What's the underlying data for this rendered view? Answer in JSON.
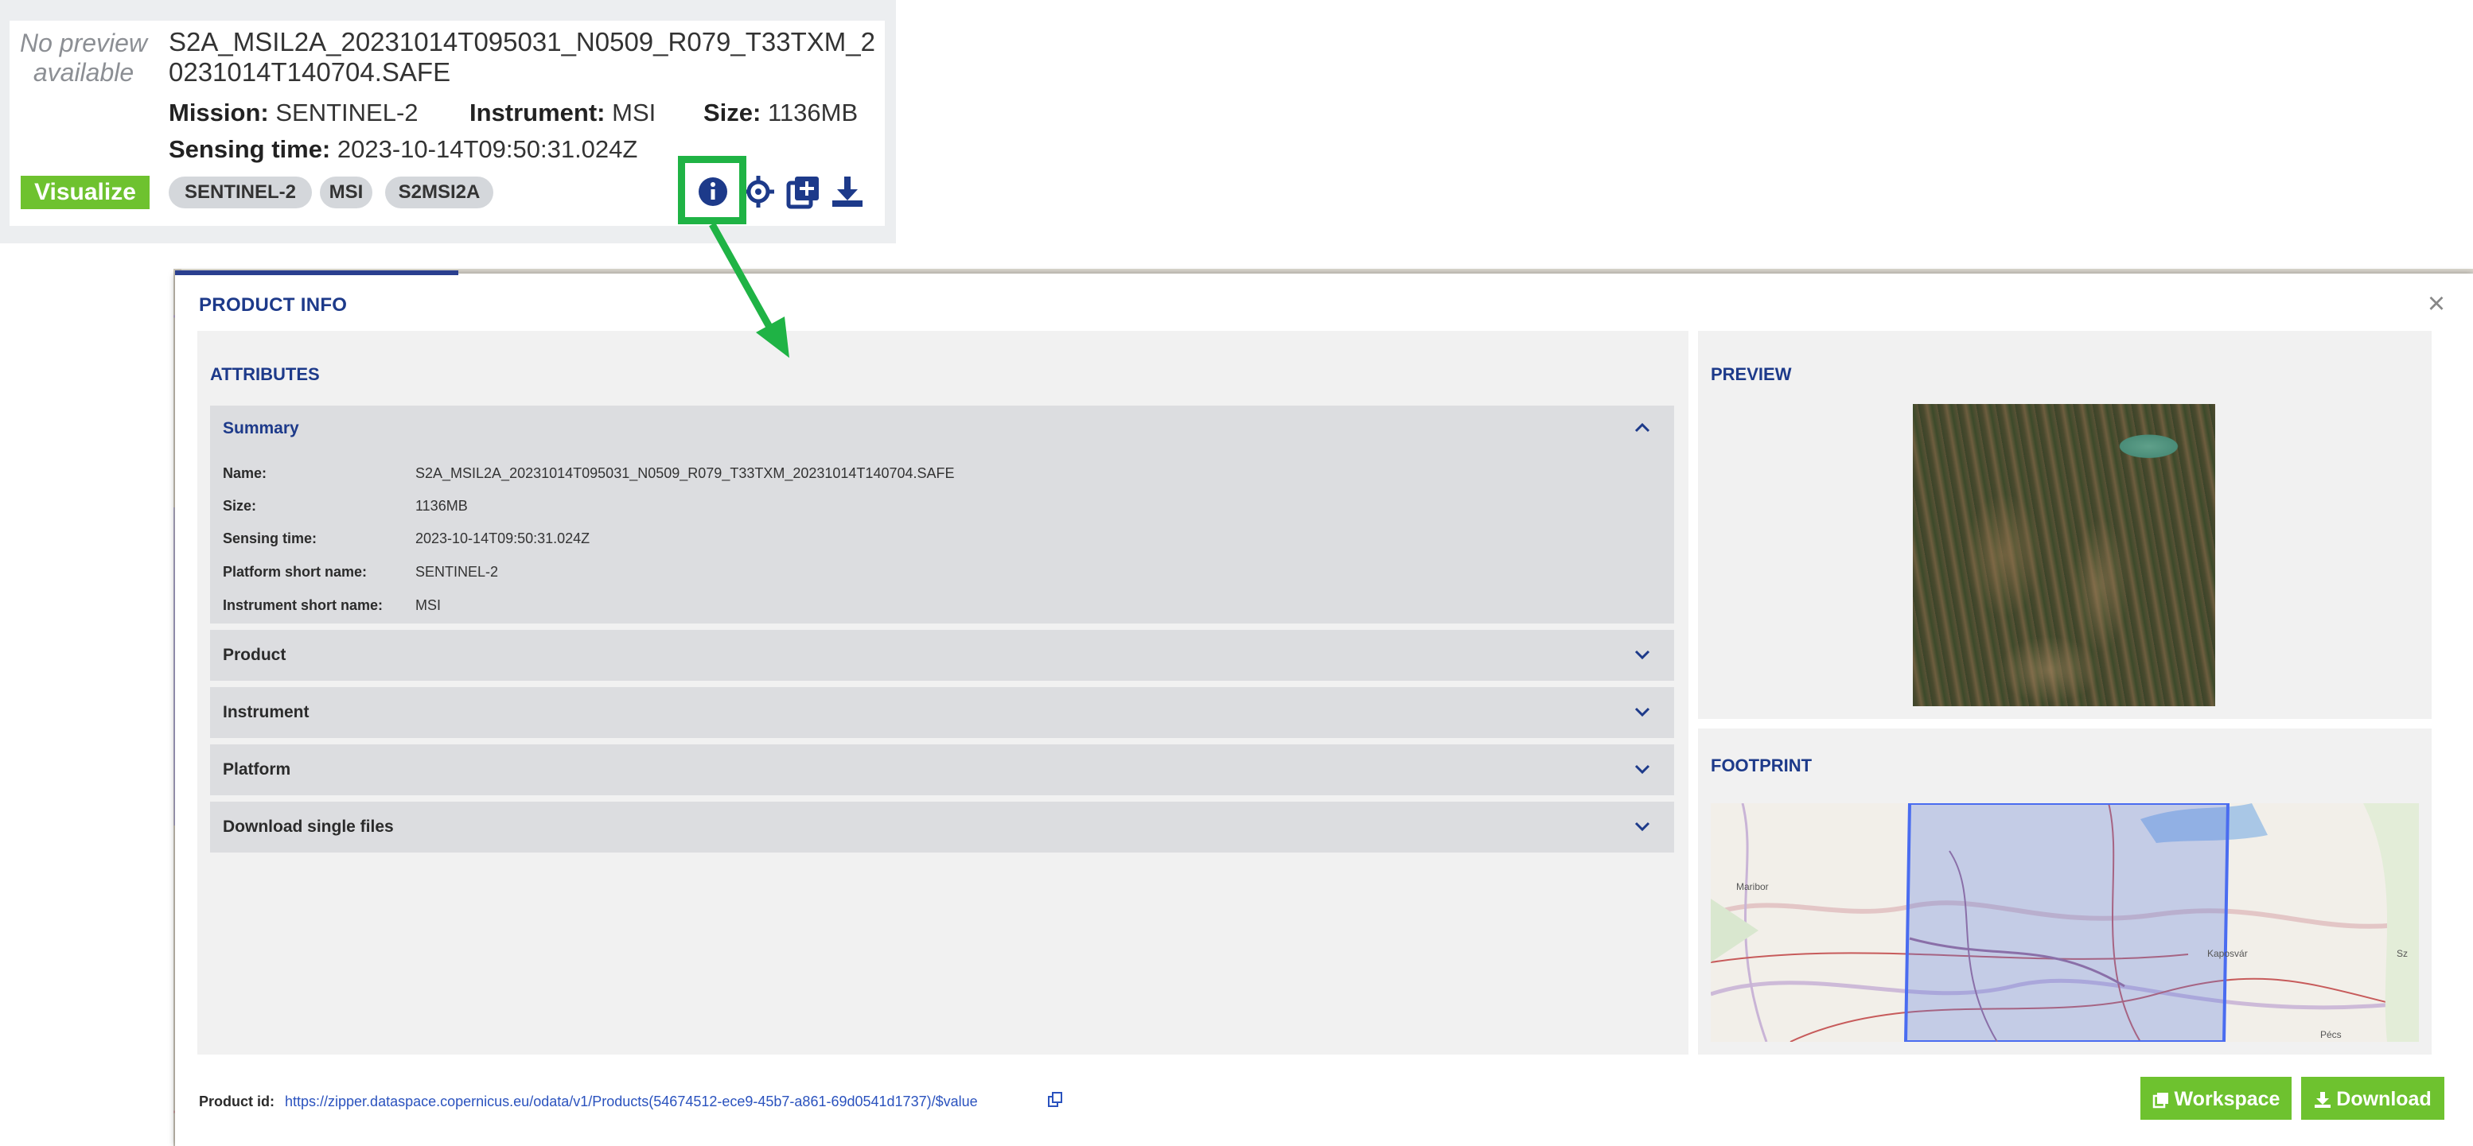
{
  "card": {
    "no_preview": "No preview available",
    "name": "S2A_MSIL2A_20231014T095031_N0509_R079_T33TXM_20231014T140704.SAFE",
    "mission_label": "Mission:",
    "mission_value": "SENTINEL-2",
    "instrument_label": "Instrument:",
    "instrument_value": "MSI",
    "size_label": "Size:",
    "size_value": "1136MB",
    "sensing_label": "Sensing time:",
    "sensing_value": "2023-10-14T09:50:31.024Z",
    "visualize_label": "Visualize",
    "tags": [
      "SENTINEL-2",
      "MSI",
      "S2MSI2A"
    ],
    "icons": [
      "info-icon",
      "crosshair-icon",
      "add-to-workspace-icon",
      "download-icon"
    ]
  },
  "modal": {
    "title": "PRODUCT INFO",
    "close": "×",
    "attributes_title": "ATTRIBUTES",
    "preview_title": "PREVIEW",
    "footprint_title": "FOOTPRINT",
    "summary": {
      "title": "Summary",
      "rows": [
        {
          "label": "Name:",
          "value": "S2A_MSIL2A_20231014T095031_N0509_R079_T33TXM_20231014T140704.SAFE"
        },
        {
          "label": "Size:",
          "value": "1136MB"
        },
        {
          "label": "Sensing time:",
          "value": "2023-10-14T09:50:31.024Z"
        },
        {
          "label": "Platform short name:",
          "value": "SENTINEL-2"
        },
        {
          "label": "Instrument short name:",
          "value": "MSI"
        }
      ]
    },
    "sections": [
      "Product",
      "Instrument",
      "Platform",
      "Download single files"
    ],
    "product_id_label": "Product id:",
    "product_id_url": "https://zipper.dataspace.copernicus.eu/odata/v1/Products(54674512-ece9-45b7-a861-69d0541d1737)/$value",
    "workspace_label": "Workspace",
    "download_label": "Download"
  },
  "map": {
    "labels": [
      "Maribor",
      "Kaposvár",
      "Pécs",
      "Sz"
    ]
  },
  "colors": {
    "accent_green": "#6ec22f",
    "highlight_green": "#1fb345",
    "title_blue": "#1d3a8a",
    "link_blue": "#2a52be",
    "footprint_blue": "#4a6cf0"
  }
}
